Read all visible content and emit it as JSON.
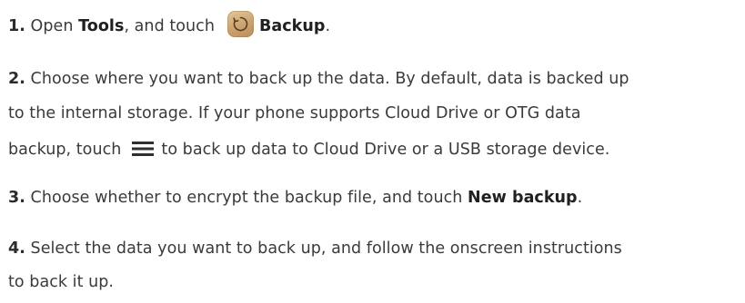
{
  "steps": [
    {
      "number": "1.",
      "text_a": " Open ",
      "tools": "Tools",
      "text_b": ", and touch",
      "backup": "Backup",
      "text_c": "."
    },
    {
      "number": "2.",
      "line1": " Choose where you want to back up the data. By default, data is backed up",
      "line2": "to the internal storage. If your phone supports Cloud Drive or OTG data",
      "line3a": "backup, touch",
      "line3b": "to back up data to Cloud Drive or a USB storage device."
    },
    {
      "number": "3.",
      "text_a": " Choose whether to encrypt the backup file, and touch ",
      "new_backup": "New backup",
      "text_b": "."
    },
    {
      "number": "4.",
      "line1": " Select the data you want to back up, and follow the onscreen instructions",
      "line2": "to back it up."
    }
  ],
  "icons": {
    "backup": "backup-icon",
    "menu": "menu-icon"
  },
  "colors": {
    "text": "#3a3a3a",
    "icon_bg": "#c9a371"
  }
}
